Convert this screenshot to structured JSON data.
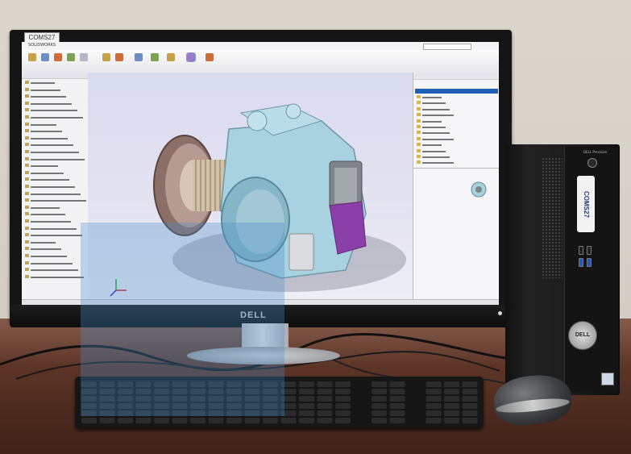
{
  "monitor": {
    "brand": "DELL",
    "asset_sticker": "COMS27"
  },
  "screen": {
    "app_name": "SOLIDWORKS",
    "document_title": "",
    "search_placeholder": "",
    "right_panel_title": "",
    "status_text": "",
    "tree_rows": [
      "",
      "",
      "",
      "",
      "",
      "",
      "",
      "",
      "",
      "",
      "",
      "",
      "",
      "",
      "",
      "",
      "",
      "",
      "",
      "",
      "",
      "",
      "",
      "",
      "",
      "",
      "",
      "",
      ""
    ],
    "colors": {
      "viewport_top": "#d9dbef",
      "part_body": "#a9d2e0",
      "part_accent": "#8b3fa8",
      "selection": "#1f5fb8"
    }
  },
  "pc": {
    "brand": "DELL Precision",
    "asset_label": "COMS27",
    "badge": "DELL"
  },
  "icons": [
    "power-button-icon",
    "usb-port-icon",
    "dell-logo-icon",
    "keyboard-icon",
    "mouse-icon"
  ]
}
